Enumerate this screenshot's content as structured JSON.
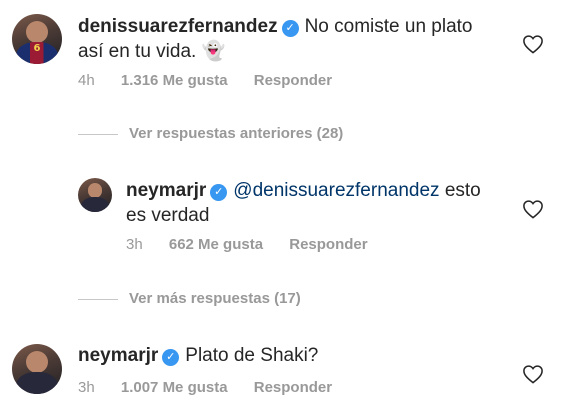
{
  "comments": [
    {
      "username": "denissuarezfernandez",
      "verified": true,
      "mention": "",
      "line1": "No comiste un plato",
      "line2": "así en tu vida. 👻",
      "time": "4h",
      "likes": "1.316 Me gusta",
      "reply": "Responder",
      "avatar_number": "6"
    },
    {
      "username": "neymarjr",
      "verified": true,
      "mention": "@denissuarezfernandez",
      "line1": "esto",
      "line2": "es verdad",
      "time": "3h",
      "likes": "662 Me gusta",
      "reply": "Responder"
    },
    {
      "username": "neymarjr",
      "verified": true,
      "mention": "",
      "line1": "Plato de Shaki?",
      "line2": "",
      "time": "3h",
      "likes": "1.007 Me gusta",
      "reply": "Responder"
    }
  ],
  "threads": {
    "previous_replies": "Ver respuestas anteriores (28)",
    "more_replies": "Ver más respuestas (17)"
  },
  "icons": {
    "verified": "verified-badge-icon",
    "like": "heart-outline-icon"
  },
  "colors": {
    "verified_blue": "#3897f0",
    "meta_gray": "#999999",
    "mention_blue": "#003569"
  }
}
